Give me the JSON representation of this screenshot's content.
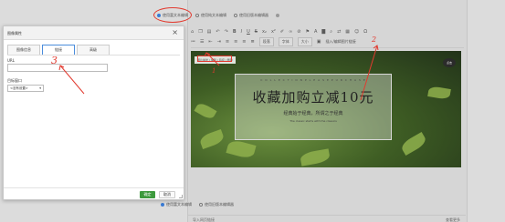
{
  "editor": {
    "mode_rich": "使用富文本编辑",
    "mode_plain": "使用纯文本编辑",
    "mode_source": "使用旧版本编辑器",
    "toolbar": {
      "format": "段落",
      "font": "字体",
      "size": "大小",
      "insert_image_label": "插入/编辑图片链接"
    },
    "image_tip": "图片描述 | 编辑 | 链接 | 删除",
    "badge": "点击",
    "footer_left": "导入网页链接",
    "footer_right": "查看更多"
  },
  "banner": {
    "small": "C O L L E C T I O N   P L E A S E   P U R C H A S E",
    "title": "收藏加购立减10元",
    "subtitle": "经典始于经典，所谓之于经典",
    "tiny": "The classic starts with the classics"
  },
  "modal": {
    "title": "图像属性",
    "tabs": [
      "图像信息",
      "链接",
      "高级"
    ],
    "url_label": "URL",
    "target_label": "目标窗口",
    "target_value": "<没有设置>",
    "ok": "确定",
    "cancel": "取消"
  },
  "annotations": [
    "1",
    "2",
    "3"
  ],
  "colors": {
    "annotation": "#e23a2f",
    "primary": "#3d9a3d",
    "tab_active_border": "#4a8cdb"
  }
}
